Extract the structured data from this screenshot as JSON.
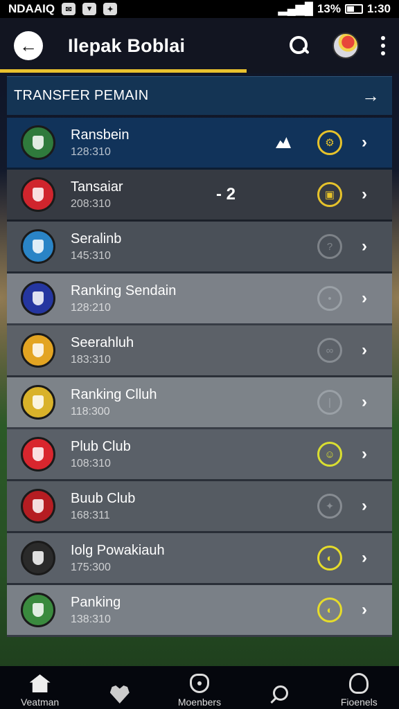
{
  "status_bar": {
    "carrier": "NDAAIQ",
    "battery": "13%",
    "time": "1:30"
  },
  "app_bar": {
    "title": "Ilepak Boblai"
  },
  "section": {
    "title": "TRANSFER PEMAIN"
  },
  "rows": [
    {
      "name": "Ransbein",
      "sub": "128:310",
      "bg": "#11335a",
      "crest": "#2f7a3c",
      "badge_color": "#e6c22b",
      "badge_glyph": "⚙"
    },
    {
      "name": "Tansaiar",
      "sub": "208:310",
      "bg": "#363a42",
      "crest": "#d0252d",
      "badge_color": "#e6c22b",
      "badge_glyph": "▣",
      "score": "- 2"
    },
    {
      "name": "Seralinb",
      "sub": "145:310",
      "bg": "#4a5058",
      "crest": "#2a84c6",
      "badge_color": "#7d8288",
      "badge_glyph": "?"
    },
    {
      "name": "Ranking Sendain",
      "sub": "128:210",
      "bg": "#7c8188",
      "crest": "#2536a0",
      "badge_color": "#9aa0a6",
      "badge_glyph": "•"
    },
    {
      "name": "Seerahluh",
      "sub": "183:310",
      "bg": "#5c6168",
      "crest": "#e3a422",
      "badge_color": "#878c92",
      "badge_glyph": "∞"
    },
    {
      "name": "Ranking Clluh",
      "sub": "118:300",
      "bg": "#7d8389",
      "crest": "#d9b22a",
      "badge_color": "#9aa0a6",
      "badge_glyph": "|"
    },
    {
      "name": "Plub Club",
      "sub": "108:310",
      "bg": "#5a6068",
      "crest": "#d9262e",
      "badge_color": "#d9de31",
      "badge_glyph": "☺"
    },
    {
      "name": "Buub Club",
      "sub": "168:311",
      "bg": "#555b62",
      "crest": "#b51d22",
      "badge_color": "#878c92",
      "badge_glyph": "✦"
    },
    {
      "name": "Iolg Powakiauh",
      "sub": "175:300",
      "bg": "#5a6068",
      "crest": "#2a2a2a",
      "badge_color": "#e6dc2a",
      "badge_glyph": "◐"
    },
    {
      "name": "Panking",
      "sub": "138:310",
      "bg": "#7a8087",
      "crest": "#3a8a3e",
      "badge_color": "#e6dc2a",
      "badge_glyph": "◐"
    }
  ],
  "bottom_nav": [
    {
      "label": "Veatman",
      "icon": "home-icon"
    },
    {
      "label": "",
      "icon": "favorite-icon"
    },
    {
      "label": "Moenbers",
      "icon": "members-icon"
    },
    {
      "label": "",
      "icon": "search-icon"
    },
    {
      "label": "Fioenels",
      "icon": "trophy-icon"
    }
  ]
}
